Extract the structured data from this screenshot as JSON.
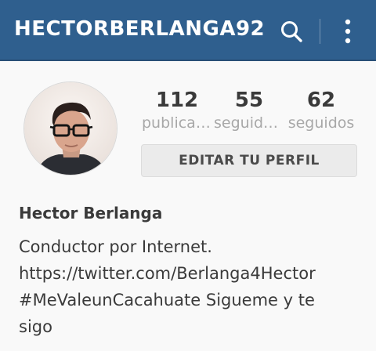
{
  "header": {
    "username": "HECTORBERLANGA92",
    "search_icon": "search-icon",
    "menu_icon": "more-vert-icon"
  },
  "profile": {
    "avatar": "profile-photo",
    "stats": [
      {
        "value": "112",
        "label": "publicaciones"
      },
      {
        "value": "55",
        "label": "seguidores"
      },
      {
        "value": "62",
        "label": "seguidos"
      }
    ],
    "edit_button_label": "EDITAR TU PERFIL",
    "full_name": "Hector Berlanga",
    "bio_lines": [
      "Conductor por Internet.",
      "https://twitter.com/Berlanga4Hector",
      "#MeValeunCacahuate Sigueme y te",
      "sigo"
    ]
  },
  "colors": {
    "header_bg": "#2f5f8e",
    "page_bg": "#f9f9f9",
    "stat_label": "#a8a8a8"
  }
}
